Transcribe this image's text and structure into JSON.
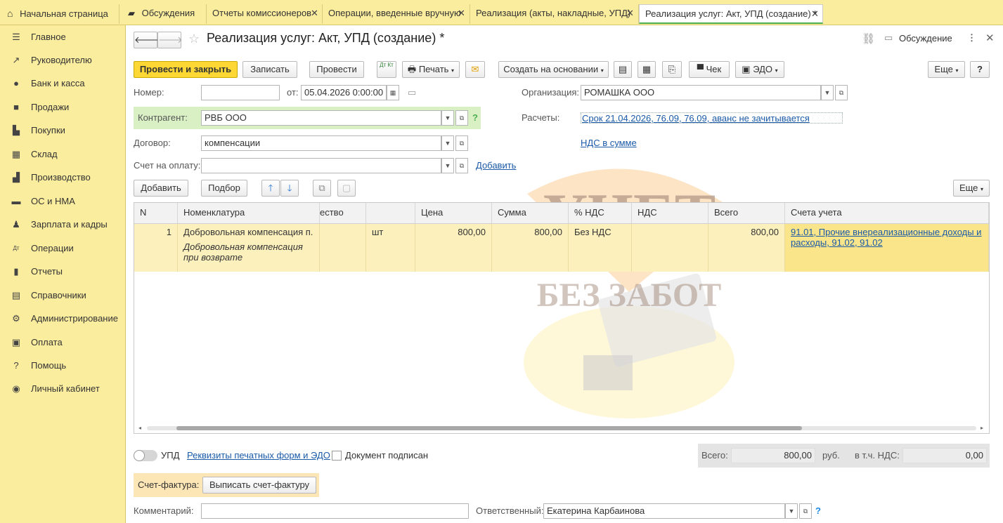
{
  "tabs": [
    {
      "label": "Начальная страница",
      "icon": "home-icon"
    },
    {
      "label": "Обсуждения",
      "icon": "chat-icon"
    },
    {
      "label": "Отчеты комиссионеров"
    },
    {
      "label": "Операции, введенные вручную"
    },
    {
      "label": "Реализация (акты, накладные, УПД)"
    },
    {
      "label": "Реализация услуг: Акт, УПД (создание) *"
    }
  ],
  "sidebar": {
    "items": [
      {
        "label": "Главное",
        "icon": "menu-icon"
      },
      {
        "label": "Руководителю",
        "icon": "trend-icon"
      },
      {
        "label": "Банк и касса",
        "icon": "coin-icon"
      },
      {
        "label": "Продажи",
        "icon": "bag-icon"
      },
      {
        "label": "Покупки",
        "icon": "cart-icon"
      },
      {
        "label": "Склад",
        "icon": "warehouse-icon"
      },
      {
        "label": "Производство",
        "icon": "factory-icon"
      },
      {
        "label": "ОС и НМА",
        "icon": "truck-icon"
      },
      {
        "label": "Зарплата и кадры",
        "icon": "person-icon"
      },
      {
        "label": "Операции",
        "icon": "dt-kt-icon"
      },
      {
        "label": "Отчеты",
        "icon": "bar-chart-icon"
      },
      {
        "label": "Справочники",
        "icon": "book-icon"
      },
      {
        "label": "Администрирование",
        "icon": "gear-icon"
      },
      {
        "label": "Оплата",
        "icon": "payment-icon"
      },
      {
        "label": "Помощь",
        "icon": "question-icon"
      },
      {
        "label": "Личный кабинет",
        "icon": "account-icon"
      }
    ]
  },
  "header": {
    "title": "Реализация услуг: Акт, УПД (создание) *",
    "discussion": "Обсуждение"
  },
  "toolbar": {
    "post_close": "Провести и закрыть",
    "save": "Записать",
    "post": "Провести",
    "dtkt": "Дт Кт",
    "print": "Печать",
    "create_based": "Создать на основании",
    "check": "Чек",
    "edo": "ЭДО",
    "more": "Еще",
    "help": "?"
  },
  "form": {
    "number_label": "Номер:",
    "number_value": "",
    "from_label": "от:",
    "date_value": "05.04.2026  0:00:00",
    "org_label": "Организация:",
    "org_value": "РОМАШКА ООО",
    "counterparty_label": "Контрагент:",
    "counterparty_value": "РВБ ООО",
    "settlements_label": "Расчеты:",
    "settlements_link": "Срок 21.04.2026, 76.09, 76.09, аванс не зачитывается",
    "contract_label": "Договор:",
    "contract_value": "компенсации",
    "vat_link": "НДС в сумме",
    "invoice_label": "Счет на оплату:",
    "invoice_value": "",
    "add_link": "Добавить"
  },
  "table_toolbar": {
    "add": "Добавить",
    "pick": "Подбор",
    "more": "Еще"
  },
  "table": {
    "columns": [
      "N",
      "Номенклатура",
      "ество",
      "Цена",
      "Сумма",
      "% НДС",
      "НДС",
      "Всего",
      "Счета учета"
    ],
    "rows": [
      {
        "n": "1",
        "item": "Добровольная компенсация п...",
        "item_note": "Добровольная компенсация при возврате",
        "unit": "шт",
        "price": "800,00",
        "sum": "800,00",
        "vat_rate": "Без НДС",
        "vat": "",
        "total": "800,00",
        "accounts": "91.01, Прочие внереализационные доходы и расходы, 91.02, 91.02"
      }
    ]
  },
  "footer": {
    "upd_label": "УПД",
    "print_forms_link": "Реквизиты печатных форм и ЭДО",
    "signed_label": "Документ подписан",
    "total_label": "Всего:",
    "total_value": "800,00",
    "currency": "руб.",
    "vat_label": "в т.ч. НДС:",
    "vat_value": "0,00",
    "invoice_label": "Счет-фактура:",
    "invoice_button": "Выписать счет-фактуру",
    "comment_label": "Комментарий:",
    "comment_value": "",
    "responsible_label": "Ответственный:",
    "responsible_value": "Екатерина Карбаинова"
  },
  "watermark": {
    "line1": "УЧЕТ",
    "line2": "БЕЗ ЗАБОТ"
  },
  "colors": {
    "accent_yellow": "#fdd835",
    "panel_yellow": "#fbed9e",
    "green_highlight": "#d9f0c4",
    "row_highlight": "#fcf0bd",
    "link_blue": "#1a5aa8"
  }
}
